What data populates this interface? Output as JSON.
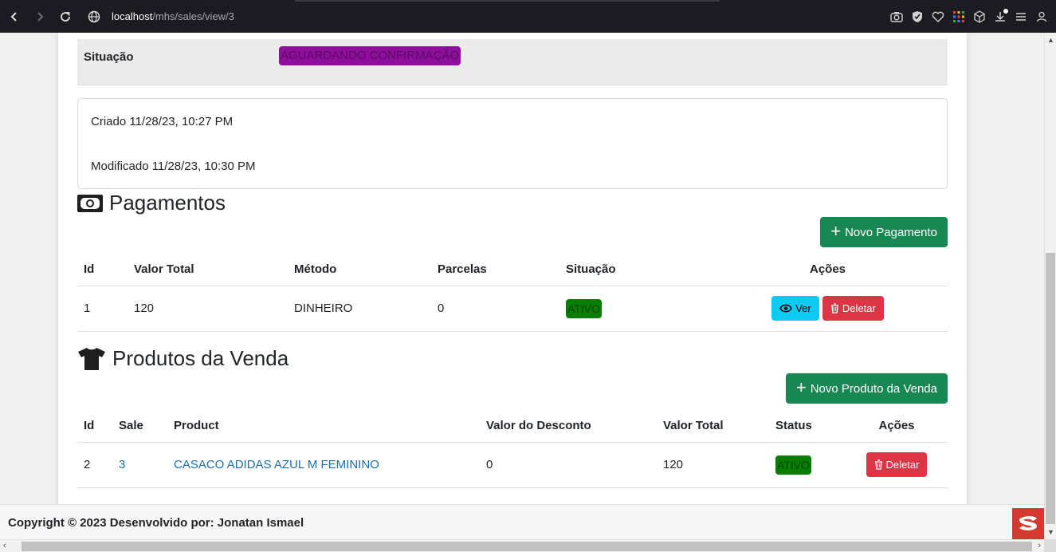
{
  "browser": {
    "url_host": "localhost",
    "url_path": "/mhs/sales/view/3"
  },
  "sale": {
    "status_label": "Situação",
    "status_value": "AGUARDANDO CONFIRMAÇÃO",
    "created": "Criado 11/28/23, 10:27 PM",
    "modified": "Modificado 11/28/23, 10:30 PM"
  },
  "payments": {
    "title": "Pagamentos",
    "new_button": "Novo Pagamento",
    "headers": [
      "Id",
      "Valor Total",
      "Método",
      "Parcelas",
      "Situação",
      "Ações"
    ],
    "rows": [
      {
        "id": "1",
        "total": "120",
        "method": "DINHEIRO",
        "installments": "0",
        "status": "ATIVO",
        "view": "Ver",
        "delete": "Deletar"
      }
    ]
  },
  "products": {
    "title": "Produtos da Venda",
    "new_button": "Novo Produto da Venda",
    "headers": [
      "Id",
      "Sale",
      "Product",
      "Valor do Desconto",
      "Valor Total",
      "Status",
      "Ações"
    ],
    "rows": [
      {
        "id": "2",
        "sale": "3",
        "product": "CASACO ADIDAS AZUL M FEMININO",
        "discount": "0",
        "total": "120",
        "status": "ATIVO",
        "delete": "Deletar"
      }
    ]
  },
  "footer": {
    "text": "Copyright © 2023 Desenvolvido por: Jonatan Ismael"
  },
  "colors": {
    "success": "#198754",
    "info": "#0dcaf0",
    "danger": "#dc3545",
    "purple_badge": "#8e0f9b",
    "green_badge": "#0a7d05",
    "link": "#1a6fb5"
  },
  "icons": {
    "payments": "money-bill-icon",
    "products": "tshirt-icon"
  }
}
